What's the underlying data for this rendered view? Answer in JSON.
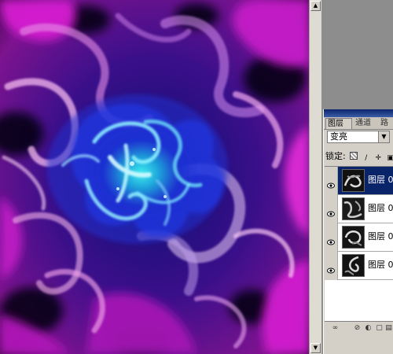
{
  "layers_panel": {
    "tabs": [
      {
        "label": "图层",
        "active": true
      },
      {
        "label": "通道",
        "active": false
      },
      {
        "label": "路",
        "active": false
      }
    ],
    "blend_mode": "变亮",
    "lock_label": "锁定:",
    "layers": [
      {
        "name": "图层 0",
        "visible": true,
        "selected": true
      },
      {
        "name": "图层 0",
        "visible": true,
        "selected": false
      },
      {
        "name": "图层 0",
        "visible": true,
        "selected": false
      },
      {
        "name": "图层 0",
        "visible": true,
        "selected": false
      }
    ]
  },
  "icons": {
    "eye": "eye-icon",
    "lock_transparency": "checker-lock-icon",
    "lock_paint": "brush-lock-icon",
    "lock_move": "move-lock-icon",
    "lock_all": "padlock-icon",
    "dropdown": "chevron-down-icon",
    "link": "link-icon",
    "style": "fx-icon",
    "new_layer": "new-layer-icon",
    "delete": "trash-icon"
  },
  "colors": {
    "canvas_magenta": "#c21cc9",
    "canvas_blue": "#1b2ed0",
    "canvas_cyan": "#35d4e0",
    "selection": "#0a246a",
    "panel_bg": "#d4d0c8"
  }
}
